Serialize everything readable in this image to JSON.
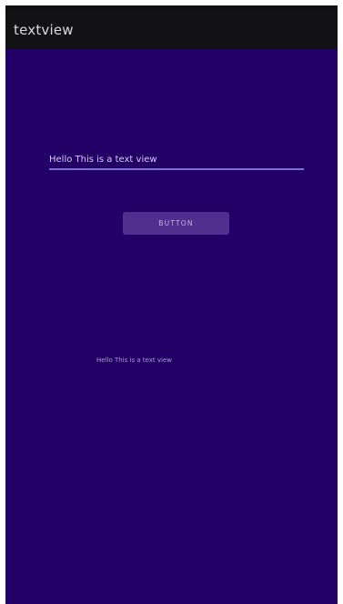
{
  "app_bar": {
    "title": "textview"
  },
  "edit_text": {
    "value": "Hello This is a text view"
  },
  "button": {
    "label": "BUTTON"
  },
  "text_view": {
    "text": "Hello This is a text view"
  },
  "colors": {
    "background": "#220066",
    "app_bar": "#121214",
    "button": "#50308e",
    "underline": "#7d6fd8"
  }
}
